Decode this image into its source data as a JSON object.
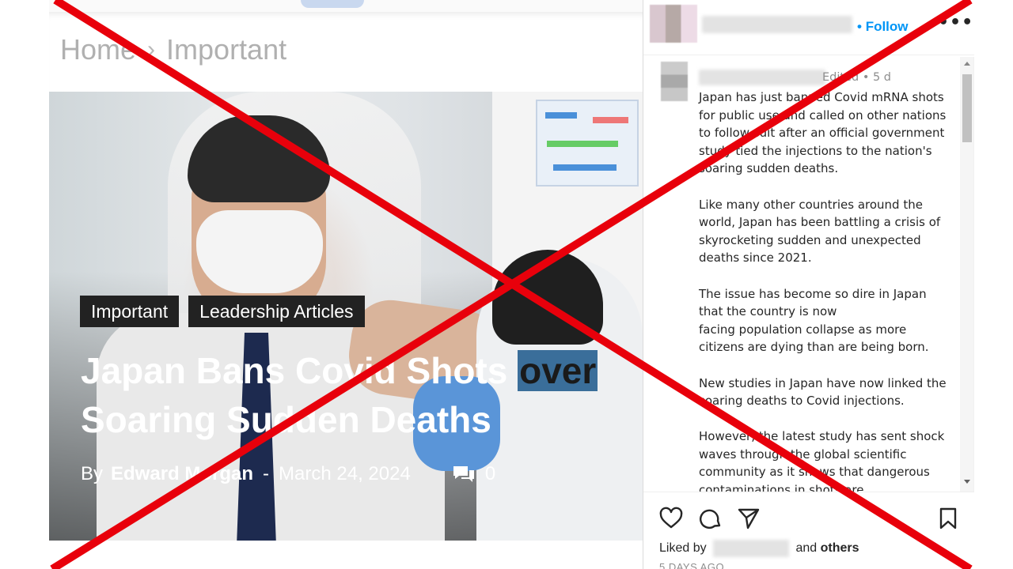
{
  "article": {
    "breadcrumb": {
      "home": "Home",
      "separator": "›",
      "current": "Important"
    },
    "tags": [
      "Important",
      "Leadership Articles"
    ],
    "headline_line1": "Japan Bans Covid Shots ",
    "headline_highlight": "over",
    "headline_line2": "Soaring Sudden Deaths",
    "by_label": "By",
    "author": "Edward Morgan",
    "dash": "-",
    "date": "March 24, 2024",
    "comment_count": "0"
  },
  "instagram": {
    "follow_label": "Follow",
    "follow_dot": "•",
    "more_label": "•••",
    "meta": "Edited • 5 d",
    "caption": "Japan has just banned Covid mRNA shots for public use and called on other nations to follow suit after an official government study tied the injections to the nation's soaring sudden deaths.\n\nLike many other countries around the world, Japan has been battling a crisis of skyrocketing sudden and unexpected deaths since 2021.\n\nThe issue has become so dire in Japan that the country is now\nfacing population collapse as more citizens are dying than are being born.\n\nNew studies in Japan have now linked the soaring deaths to Covid injections.\n\nHowever, the latest study has sent shock waves through the global scientific community as it shows that dangerous contaminations in shots are",
    "liked_by": "Liked by",
    "and_label": "and",
    "others_label": "others",
    "time_ago": "5 DAYS AGO"
  },
  "colors": {
    "accent_blue": "#0095f6",
    "x_red": "#e8000b",
    "tag_bg": "#222222"
  },
  "icons": [
    "comment-bubble-icon",
    "heart-icon",
    "comment-icon",
    "share-icon",
    "bookmark-icon",
    "more-icon"
  ]
}
